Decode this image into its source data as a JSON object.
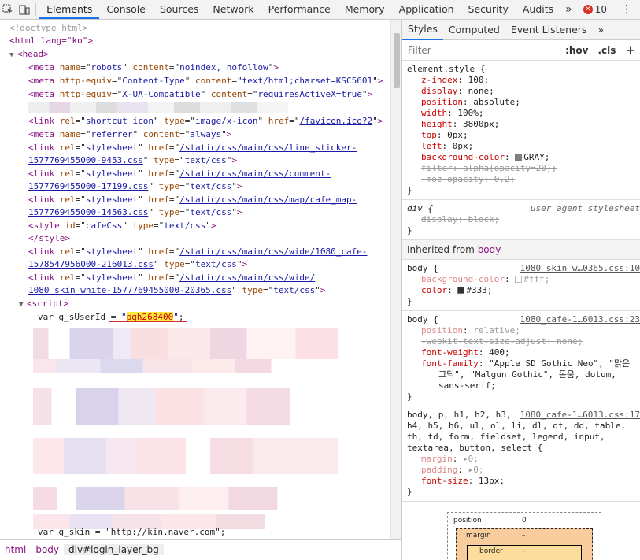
{
  "toolbar": {
    "tabs": [
      "Elements",
      "Console",
      "Sources",
      "Network",
      "Performance",
      "Memory",
      "Application",
      "Security",
      "Audits"
    ],
    "more": "»",
    "error_count": "10",
    "kebab": "⋮"
  },
  "tree": {
    "doctype": "<!doctype html>",
    "html_open": "<html lang=\"ko\">",
    "head_open": "<head>",
    "meta_robots_name": "robots",
    "meta_robots_content": "noindex, nofollow",
    "meta_ct_equiv": "Content-Type",
    "meta_ct_content": "text/html;charset=KSC5601",
    "meta_xua_equiv": "X-UA-Compatible",
    "meta_xua_content": "requiresActiveX=true",
    "link_icon_rel": "shortcut icon",
    "link_icon_type": "image/x-icon",
    "link_icon_href": "/favicon.ico?2",
    "meta_ref_name": "referrer",
    "meta_ref_content": "always",
    "css1_a": "/static/css/main/css/line_sticker-",
    "css1_b": "1577769455000-9453.css",
    "css2_a": "/static/css/main/css/comment-",
    "css2_b": "1577769455000-17199.css",
    "css3_a": "/static/css/main/css/map/cafe_map-",
    "css3_b": "1577769455000-14563.css",
    "style_id": "cafeCss",
    "style_close": "</style>",
    "css4_a": "/static/css/main/css/wide/1080_cafe-",
    "css4_b": "1578547956000-216013.css",
    "css5_a": "/static/css/main/css/wide/",
    "css5_b": "1080_skin_white-1577769455000-20365.css",
    "stylesheet": "stylesheet",
    "text_css": "text/css",
    "script_open": "<script>",
    "userid_prefix": "var g_sUserId = ",
    "userid_value": "pgh268400",
    "g_skin_line": "var g_skin = \"http://kin.naver.com\";"
  },
  "breadcrumbs": [
    "html",
    "body",
    "div#login_layer_bg"
  ],
  "styles": {
    "tabs": [
      "Styles",
      "Computed",
      "Event Listeners"
    ],
    "more": "»",
    "filter_placeholder": "Filter",
    "hov": ":hov",
    "cls": ".cls",
    "plus": "+",
    "element_style_selector": "element.style {",
    "element_style": [
      {
        "name": "z-index",
        "value": "100;"
      },
      {
        "name": "display",
        "value": "none;"
      },
      {
        "name": "position",
        "value": "absolute;"
      },
      {
        "name": "width",
        "value": "100%;"
      },
      {
        "name": "height",
        "value": "3800px;"
      },
      {
        "name": "top",
        "value": "0px;"
      },
      {
        "name": "left",
        "value": "0px;"
      },
      {
        "name": "background-color",
        "value": "GRAY;"
      },
      {
        "name": "filter",
        "value": "alpha(opacity=20);"
      },
      {
        "name": "-moz-opacity",
        "value": "0.2;"
      }
    ],
    "div_selector": "div {",
    "div_source": "user agent stylesheet",
    "div_display": "display: block;",
    "inherited_label": "Inherited from",
    "inherited_from": "body",
    "rule1_selector": "body {",
    "rule1_source": "1080_skin_w…0365.css:10",
    "rule1_bg": {
      "name": "background-color",
      "value": "#fff;"
    },
    "rule1_color": {
      "name": "color",
      "value": "#333;"
    },
    "rule2_selector": "body {",
    "rule2_source": "1080_cafe-1…6013.css:23",
    "rule2_position": {
      "name": "position",
      "value": "relative;"
    },
    "rule2_webkit": "-webkit-text-size-adjust: none;",
    "rule2_fw": {
      "name": "font-weight",
      "value": "400;"
    },
    "rule2_ff_name": "font-family",
    "rule2_ff_1": "\"Apple SD Gothic Neo\", \"맑은",
    "rule2_ff_2": "고딕\", \"Malgun Gothic\", 돋움, dotum,",
    "rule2_ff_3": "sans-serif;",
    "rule3_sel_1": "body, p, h1, h2, h3,",
    "rule3_source": "1080_cafe-1…6013.css:17",
    "rule3_sel_2": "h4, h5, h6, ul, ol, li, dl, dt, dd, table,",
    "rule3_sel_3": "th, td, form, fieldset, legend, input,",
    "rule3_sel_4": "textarea, button, select {",
    "rule3_margin": {
      "name": "margin",
      "value": "0;"
    },
    "rule3_padding": {
      "name": "padding",
      "value": "0;"
    },
    "rule3_fs": {
      "name": "font-size",
      "value": "13px;"
    },
    "close_brace": "}",
    "boxmodel": {
      "position_label": "position",
      "position_value": "0",
      "margin_label": "margin",
      "margin_value": "–",
      "border_label": "border",
      "border_value": "–"
    }
  },
  "colors": {
    "accent": "#1a73e8",
    "error": "#d93025",
    "tag": "#881280",
    "attr_name": "#994500",
    "attr_value": "#1a1aa6",
    "highlight": "#ffeb3b"
  }
}
